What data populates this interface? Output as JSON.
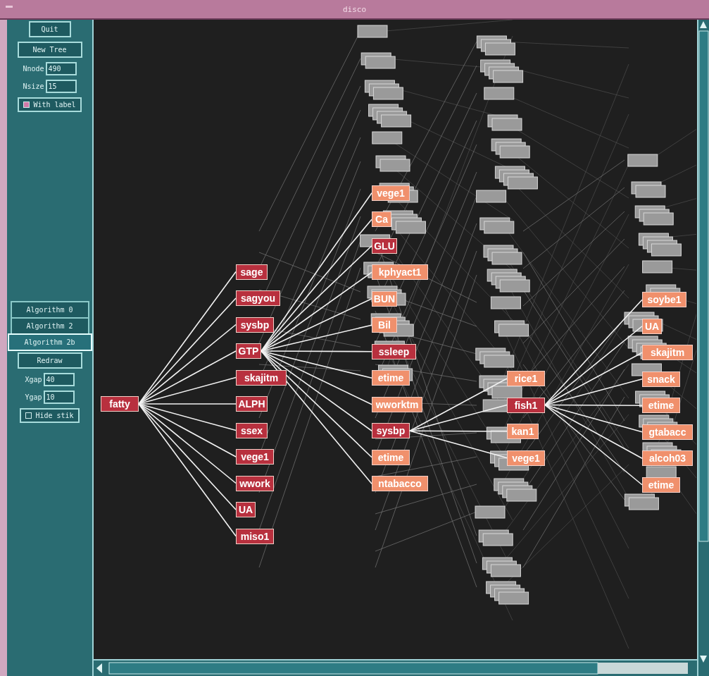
{
  "window": {
    "title": "disco"
  },
  "controls": {
    "top": [
      {
        "kind": "button",
        "label": "Quit"
      },
      {
        "kind": "button",
        "label": "New Tree"
      },
      {
        "kind": "field",
        "label": "Nnode",
        "value": "490"
      },
      {
        "kind": "field",
        "label": "Nsize",
        "value": "15"
      },
      {
        "kind": "checkbox",
        "label": "With label",
        "checked": true
      }
    ],
    "bottom": [
      {
        "kind": "option",
        "label": "Algorithm 0",
        "selected": false
      },
      {
        "kind": "option",
        "label": "Algorithm 2",
        "selected": false
      },
      {
        "kind": "option",
        "label": "Algorithm 2b",
        "selected": true
      },
      {
        "kind": "button",
        "label": "Redraw"
      },
      {
        "kind": "field",
        "label": "Xgap",
        "value": "40"
      },
      {
        "kind": "field",
        "label": "Ygap",
        "value": "10"
      },
      {
        "kind": "checkbox",
        "label": "Hide stik",
        "checked": false
      }
    ]
  },
  "tree": {
    "label": "fatty",
    "color": "#b8303e",
    "children": [
      {
        "label": "sage",
        "color": "#b8303e"
      },
      {
        "label": "sagyou",
        "color": "#b8303e"
      },
      {
        "label": "sysbp",
        "color": "#b8303e"
      },
      {
        "label": "GTP",
        "color": "#b8303e",
        "children": [
          {
            "label": "vege1",
            "color": "#f0906c"
          },
          {
            "label": "Ca",
            "color": "#f0906c"
          },
          {
            "label": "GLU",
            "color": "#b8303e"
          },
          {
            "label": "kphyact1",
            "color": "#f0906c"
          },
          {
            "label": "BUN",
            "color": "#f0906c"
          },
          {
            "label": "Bil",
            "color": "#f0906c"
          },
          {
            "label": "ssleep",
            "color": "#b8303e"
          },
          {
            "label": "etime",
            "color": "#f0906c"
          },
          {
            "label": "wworktm",
            "color": "#f0906c"
          },
          {
            "label": "sysbp",
            "color": "#b8303e",
            "children": [
              {
                "label": "rice1",
                "color": "#f0906c"
              },
              {
                "label": "fish1",
                "color": "#b8303e",
                "children": [
                  {
                    "label": "soybe1",
                    "color": "#f0906c"
                  },
                  {
                    "label": "UA",
                    "color": "#f0906c"
                  },
                  {
                    "label": "skajitm",
                    "color": "#f0906c"
                  },
                  {
                    "label": "snack",
                    "color": "#f0906c"
                  },
                  {
                    "label": "etime",
                    "color": "#f0906c"
                  },
                  {
                    "label": "gtabacc",
                    "color": "#f0906c"
                  },
                  {
                    "label": "alcoh03",
                    "color": "#f0906c"
                  },
                  {
                    "label": "etime",
                    "color": "#f0906c"
                  }
                ]
              },
              {
                "label": "kan1",
                "color": "#f0906c"
              },
              {
                "label": "vege1",
                "color": "#f0906c"
              }
            ]
          },
          {
            "label": "etime",
            "color": "#f0906c"
          },
          {
            "label": "ntabacco",
            "color": "#f0906c"
          }
        ]
      },
      {
        "label": "skajitm",
        "color": "#b8303e"
      },
      {
        "label": "ALPH",
        "color": "#b8303e"
      },
      {
        "label": "ssex",
        "color": "#b8303e"
      },
      {
        "label": "vege1",
        "color": "#b8303e"
      },
      {
        "label": "wwork",
        "color": "#b8303e"
      },
      {
        "label": "UA",
        "color": "#b8303e"
      },
      {
        "label": "miso1",
        "color": "#b8303e"
      }
    ]
  }
}
